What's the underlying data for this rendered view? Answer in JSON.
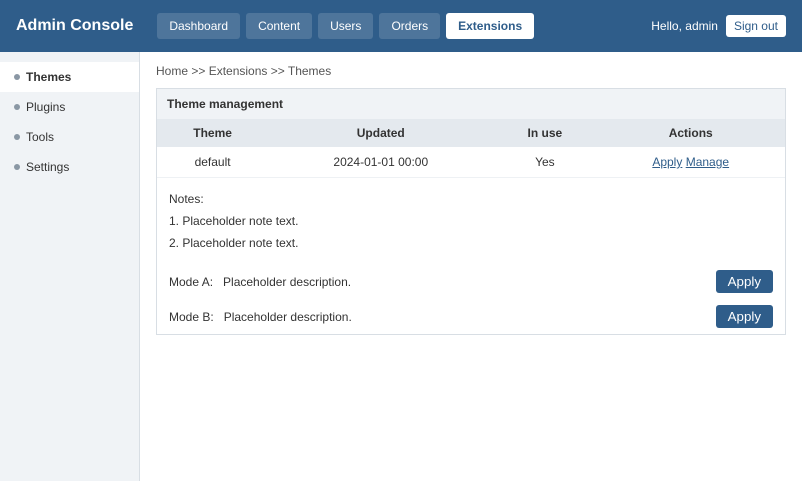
{
  "header": {
    "brand": "Admin Console",
    "tabs": [
      {
        "label": "Dashboard"
      },
      {
        "label": "Content"
      },
      {
        "label": "Users"
      },
      {
        "label": "Orders"
      },
      {
        "label": "Extensions"
      }
    ],
    "user_greeting": "Hello, admin",
    "logout_label": "Sign out"
  },
  "sidebar": {
    "items": [
      {
        "label": "Themes"
      },
      {
        "label": "Plugins"
      },
      {
        "label": "Tools"
      },
      {
        "label": "Settings"
      }
    ]
  },
  "breadcrumb": "Home >> Extensions >> Themes",
  "panel": {
    "title": "Theme management",
    "columns": [
      "Theme",
      "Updated",
      "In use",
      "Actions"
    ],
    "rows": [
      {
        "name": "default",
        "updated": "2024-01-01 00:00",
        "in_use": "Yes",
        "apply": "Apply",
        "manage": "Manage"
      }
    ]
  },
  "notes": {
    "heading": "Notes:",
    "items": [
      "1. Placeholder note text.",
      "2. Placeholder note text."
    ]
  },
  "modes": [
    {
      "label": "Mode A:",
      "desc": "Placeholder description.",
      "button": "Apply"
    },
    {
      "label": "Mode B:",
      "desc": "Placeholder description.",
      "button": "Apply"
    }
  ]
}
